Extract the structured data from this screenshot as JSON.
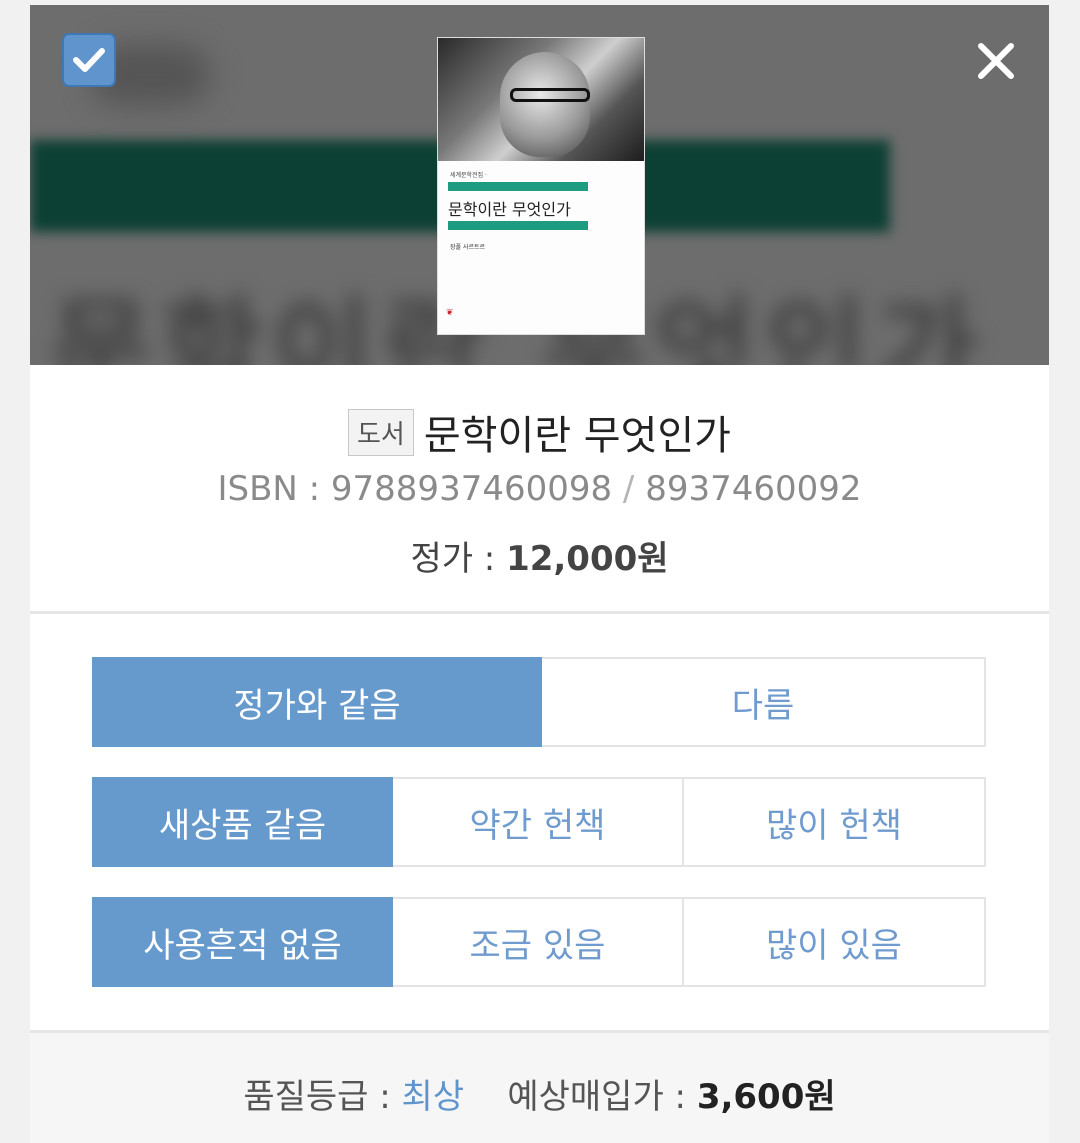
{
  "book": {
    "cover_series": "세계문학전집 ·",
    "cover_title": "문학이란 무엇인가",
    "cover_author": "장폴 사르트르",
    "badge": "도서",
    "title": "문학이란 무엇인가",
    "isbn_label": "ISBN : ",
    "isbn13": "9788937460098",
    "isbn_sep": " / ",
    "isbn10": "8937460092",
    "price_label": "정가 : ",
    "price_value": "12,000원"
  },
  "options": {
    "price_match": [
      {
        "label": "정가와 같음",
        "selected": true
      },
      {
        "label": "다름",
        "selected": false
      }
    ],
    "condition": [
      {
        "label": "새상품 같음",
        "selected": true
      },
      {
        "label": "약간 헌책",
        "selected": false
      },
      {
        "label": "많이 헌책",
        "selected": false
      }
    ],
    "usage": [
      {
        "label": "사용흔적 없음",
        "selected": true
      },
      {
        "label": "조금 있음",
        "selected": false
      },
      {
        "label": "많이 있음",
        "selected": false
      }
    ]
  },
  "footer": {
    "grade_label": "품질등급 : ",
    "grade_value": "최상",
    "buy_label": "예상매입가 : ",
    "buy_value": "3,600원"
  },
  "colors": {
    "accent": "#6699cc",
    "check": "#5f94cc"
  },
  "icons": {
    "check": "check-icon",
    "close": "close-icon"
  }
}
